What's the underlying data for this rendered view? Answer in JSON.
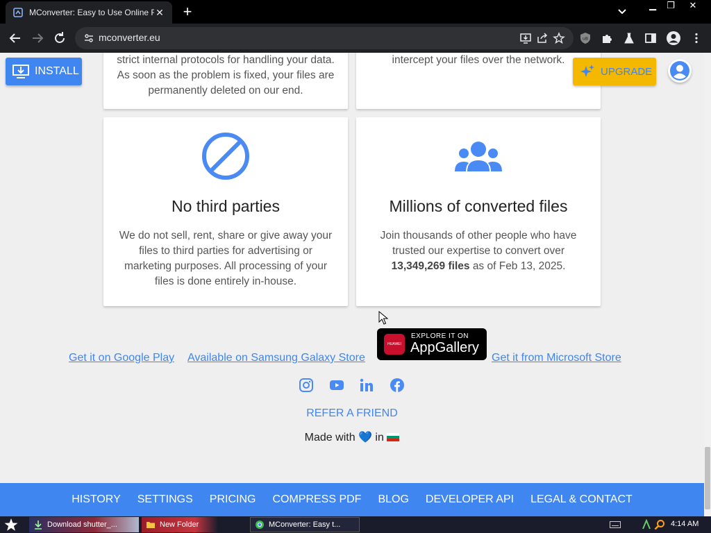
{
  "browser": {
    "tab_title": "MConverter: Easy to Use Online File",
    "url": "mconverter.eu"
  },
  "header": {
    "install_label": "INSTALL",
    "upgrade_label": "UPGRADE"
  },
  "cards": {
    "top_left_text": "strict internal protocols for handling your data. As soon as the problem is fixed, your files are permanently deleted on our end.",
    "top_right_text": "intercept your files over the network.",
    "no_third_parties": {
      "title": "No third parties",
      "text": "We do not sell, rent, share or give away your files to third parties for advertising or marketing purposes. All processing of your files is done entirely in-house."
    },
    "millions": {
      "title": "Millions of converted files",
      "text_before": "Join thousands of other people who have trusted our expertise to convert over",
      "count": "13,349,269 files",
      "text_after": "as of Feb 13, 2025."
    }
  },
  "stores": {
    "google_play": "Get it on Google Play",
    "samsung": "Available on Samsung Galaxy Store",
    "appgallery_small": "EXPLORE IT ON",
    "appgallery_big": "AppGallery",
    "appgallery_brand": "HUAWEI",
    "microsoft": "Get it from Microsoft Store"
  },
  "social": [
    "instagram-icon",
    "youtube-icon",
    "linkedin-icon",
    "facebook-icon"
  ],
  "refer_label": "REFER A FRIEND",
  "made_with": {
    "before": "Made with",
    "heart": "💙",
    "middle": "in"
  },
  "footer": {
    "links": [
      "HISTORY",
      "SETTINGS",
      "PRICING",
      "COMPRESS PDF",
      "BLOG",
      "DEVELOPER API",
      "LEGAL & CONTACT"
    ]
  },
  "taskbar": {
    "items": [
      "Download shutter_...",
      "New Folder",
      "MConverter: Easy t..."
    ],
    "clock": "4:14 AM"
  },
  "colors": {
    "accent": "#3f86f0",
    "upgrade": "#f5b800",
    "page_bg": "#efefef"
  }
}
